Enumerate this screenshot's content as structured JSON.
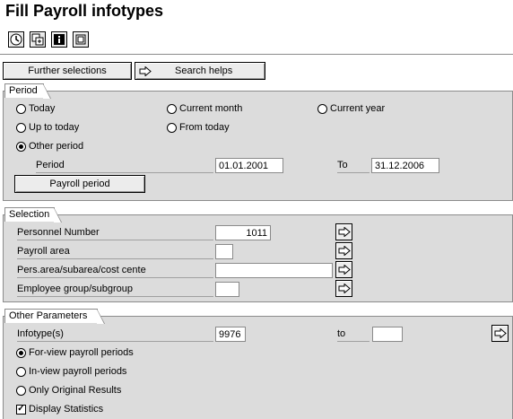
{
  "title": "Fill Payroll infotypes",
  "toolbar": {
    "icons": [
      "execute-icon",
      "copy-icon",
      "info-icon",
      "fullscreen-icon"
    ]
  },
  "top_buttons": {
    "further_selections": "Further selections",
    "search_helps": "Search helps"
  },
  "period": {
    "title": "Period",
    "options": {
      "today": "Today",
      "current_month": "Current month",
      "current_year": "Current year",
      "up_to_today": "Up to today",
      "from_today": "From today",
      "other_period": "Other period"
    },
    "selected": "other_period",
    "period_label": "Period",
    "from_value": "01.01.2001",
    "to_label": "To",
    "to_value": "31.12.2006",
    "payroll_button": "Payroll period"
  },
  "selection": {
    "title": "Selection",
    "rows": [
      {
        "label": "Personnel Number",
        "value": "1011"
      },
      {
        "label": "Payroll area",
        "value": ""
      },
      {
        "label": "Pers.area/subarea/cost cente",
        "value": ""
      },
      {
        "label": "Employee group/subgroup",
        "value": ""
      }
    ]
  },
  "other": {
    "title": "Other Parameters",
    "infotype_label": "Infotype(s)",
    "infotype_value": "9976",
    "to_label": "to",
    "to_value": "",
    "options": {
      "for_view": "For-view payroll periods",
      "in_view": "In-view payroll periods",
      "original": "Only Original Results"
    },
    "selected": "for_view",
    "display_statistics": "Display Statistics",
    "display_statistics_checked": true
  }
}
